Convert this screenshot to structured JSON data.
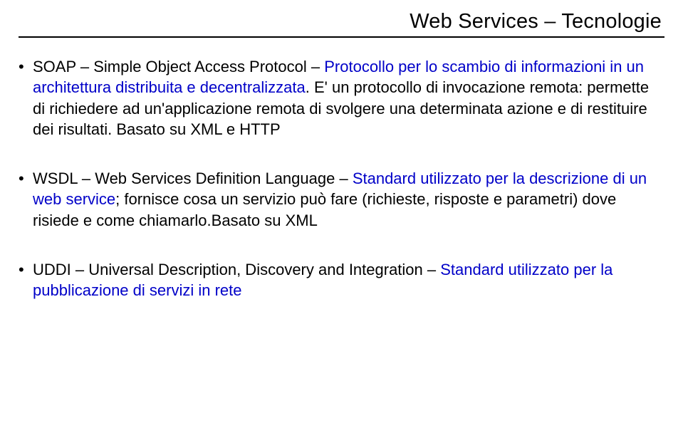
{
  "title": "Web Services – Tecnologie",
  "bullets": [
    {
      "lead": "SOAP – Simple Object Access Protocol – ",
      "blue1": "Protocollo per lo scambio di informazioni in un architettura distribuita e decentralizzata",
      "plain2": ". E' un protocollo di invocazione remota: permette di richiedere ad un'applicazione remota di svolgere una determinata azione e di restituire dei risultati. Basato su XML e HTTP"
    },
    {
      "lead": "WSDL – Web Services Definition Language – ",
      "blue1": "Standard utilizzato per la descrizione di un web service",
      "plain2": "; fornisce cosa un servizio può fare (richieste, risposte e parametri) dove risiede e come chiamarlo.Basato su XML"
    },
    {
      "lead": "UDDI – Universal Description, Discovery and Integration – ",
      "blue1": "Standard utilizzato per la pubblicazione di servizi in rete",
      "plain2": ""
    }
  ]
}
